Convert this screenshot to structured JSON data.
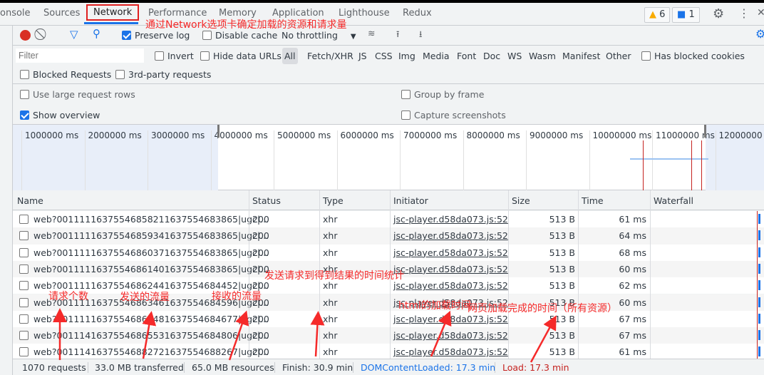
{
  "tabs": [
    "onsole",
    "Sources",
    "Network",
    "Performance",
    "Memory",
    "Application",
    "Lighthouse",
    "Redux"
  ],
  "active_tab": "Network",
  "badges": {
    "warnings": "6",
    "messages": "1"
  },
  "toolbar": {
    "preserve_log": "Preserve log",
    "preserve_log_checked": true,
    "disable_cache": "Disable cache",
    "throttling": "No throttling"
  },
  "filter": {
    "placeholder": "Filter",
    "invert": "Invert",
    "hide_data_urls": "Hide data URLs",
    "types": [
      "All",
      "Fetch/XHR",
      "JS",
      "CSS",
      "Img",
      "Media",
      "Font",
      "Doc",
      "WS",
      "Wasm",
      "Manifest",
      "Other"
    ],
    "has_blocked_cookies": "Has blocked cookies",
    "blocked_requests": "Blocked Requests",
    "third_party": "3rd-party requests"
  },
  "settings": {
    "large_rows": "Use large request rows",
    "show_overview": "Show overview",
    "show_overview_checked": true,
    "group_by_frame": "Group by frame",
    "capture_screenshots": "Capture screenshots"
  },
  "overview_ticks": [
    "1000000 ms",
    "2000000 ms",
    "3000000 ms",
    "4000000 ms",
    "5000000 ms",
    "6000000 ms",
    "7000000 ms",
    "8000000 ms",
    "9000000 ms",
    "10000000 ms",
    "11000000 ms",
    "12000000 ms"
  ],
  "columns": [
    "Name",
    "Status",
    "Type",
    "Initiator",
    "Size",
    "Time",
    "Waterfall"
  ],
  "rows": [
    {
      "name": "web?00111116375546858211637554683865|ugc|...",
      "status": "200",
      "type": "xhr",
      "initiator": "jsc-player.d58da073.js:52",
      "size": "513 B",
      "time": "61 ms"
    },
    {
      "name": "web?00111116375546859341637554683865|ugc|...",
      "status": "200",
      "type": "xhr",
      "initiator": "jsc-player.d58da073.js:52",
      "size": "513 B",
      "time": "64 ms"
    },
    {
      "name": "web?00111116375546860371637554683865|ugc|...",
      "status": "200",
      "type": "xhr",
      "initiator": "jsc-player.d58da073.js:52",
      "size": "513 B",
      "time": "68 ms"
    },
    {
      "name": "web?00111116375546861401637554683865|ugc|...",
      "status": "200",
      "type": "xhr",
      "initiator": "jsc-player.d58da073.js:52",
      "size": "513 B",
      "time": "60 ms"
    },
    {
      "name": "web?00111116375546862441637554684452|ugc|...",
      "status": "200",
      "type": "xhr",
      "initiator": "jsc-player.d58da073.js:52",
      "size": "513 B",
      "time": "62 ms"
    },
    {
      "name": "web?00111116375546863461637554684596|ugc|...",
      "status": "200",
      "type": "xhr",
      "initiator": "jsc-player.d58da073.js:52",
      "size": "513 B",
      "time": "60 ms"
    },
    {
      "name": "web?00111116375546864481637554684677|ugc|...",
      "status": "200",
      "type": "xhr",
      "initiator": "jsc-player.d58da073.js:52",
      "size": "513 B",
      "time": "67 ms"
    },
    {
      "name": "web?00111416375546865531637554684806|ugc|...",
      "status": "200",
      "type": "xhr",
      "initiator": "jsc-player.d58da073.js:52",
      "size": "513 B",
      "time": "67 ms"
    },
    {
      "name": "web?00111416375546882721637554688267|ugc|...",
      "status": "200",
      "type": "xhr",
      "initiator": "jsc-player.d58da073.js:52",
      "size": "513 B",
      "time": "61 ms"
    }
  ],
  "summary": {
    "requests": "1070 requests",
    "transferred": "33.0 MB transferred",
    "resources": "65.0 MB resources",
    "finish": "Finish: 30.9 min",
    "dcl": "DOMContentLoaded: 17.3 min",
    "load": "Load: 17.3 min"
  },
  "colors": {
    "accent": "#1a73e8",
    "record": "#d93025",
    "dcl": "#1a73e8",
    "load": "#c5221f",
    "annotation": "#f52a2a"
  },
  "annotations": {
    "tab_note": "通过Network选项卡确定加载的资源和请求量",
    "requests_note": "请求个数",
    "sent_note": "发送的流量",
    "received_note": "接收的流量",
    "timing_note": "发送请求到得到结果的时间统计",
    "html_note": "html的加载时间",
    "load_note": "网页加载完成的时间（所有资源）"
  }
}
